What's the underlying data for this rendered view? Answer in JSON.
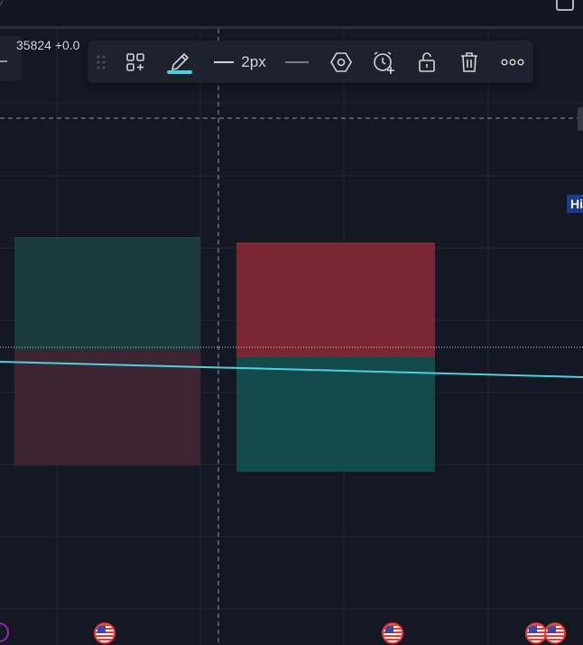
{
  "header": {
    "top_left_glyph": "⁄",
    "corner_icon": "fullscreen-icon"
  },
  "legend": {
    "price_text": "35824  +0.0"
  },
  "toolbar": {
    "drag_icon": "drag-handle-icon",
    "templates_icon": "templates-icon",
    "color_icon": "pencil-icon",
    "color_accent": "#4dd0e1",
    "line_width_label": "2px",
    "style_icon": "line-style-icon",
    "visibility_icon": "hexagon-settings-icon",
    "alert_icon": "add-alert-icon",
    "lock_icon": "unlock-icon",
    "delete_icon": "trash-icon",
    "more_icon": "more-icon"
  },
  "price_axis": {
    "label": "Hi"
  },
  "colors": {
    "background": "#141823",
    "teal": "#134b4a",
    "red": "#7a2733",
    "trend_line": "#4dd0e1"
  },
  "events": [
    {
      "type": "purple-event-icon"
    },
    {
      "type": "us-flag-icon"
    },
    {
      "type": "us-flag-icon"
    },
    {
      "type": "us-flag-icon"
    },
    {
      "type": "us-flag-icon"
    }
  ]
}
